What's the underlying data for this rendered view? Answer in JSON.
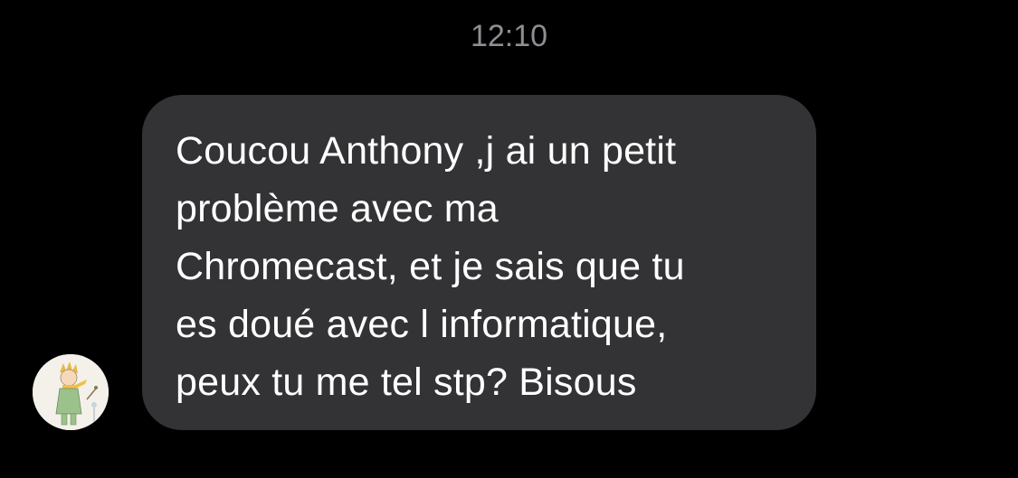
{
  "timestamp": "12:10",
  "message": {
    "sender_avatar_icon": "little-prince-avatar-icon",
    "lines": [
      "Coucou Anthony ,j ai un petit",
      "problème avec ma",
      "Chromecast, et je sais que tu",
      "es doué avec l informatique,",
      "peux tu me tel stp? Bisous"
    ],
    "bubble_color": "#333335",
    "text_color": "#ffffff"
  },
  "colors": {
    "background": "#000000",
    "timestamp": "#8e8e93"
  }
}
